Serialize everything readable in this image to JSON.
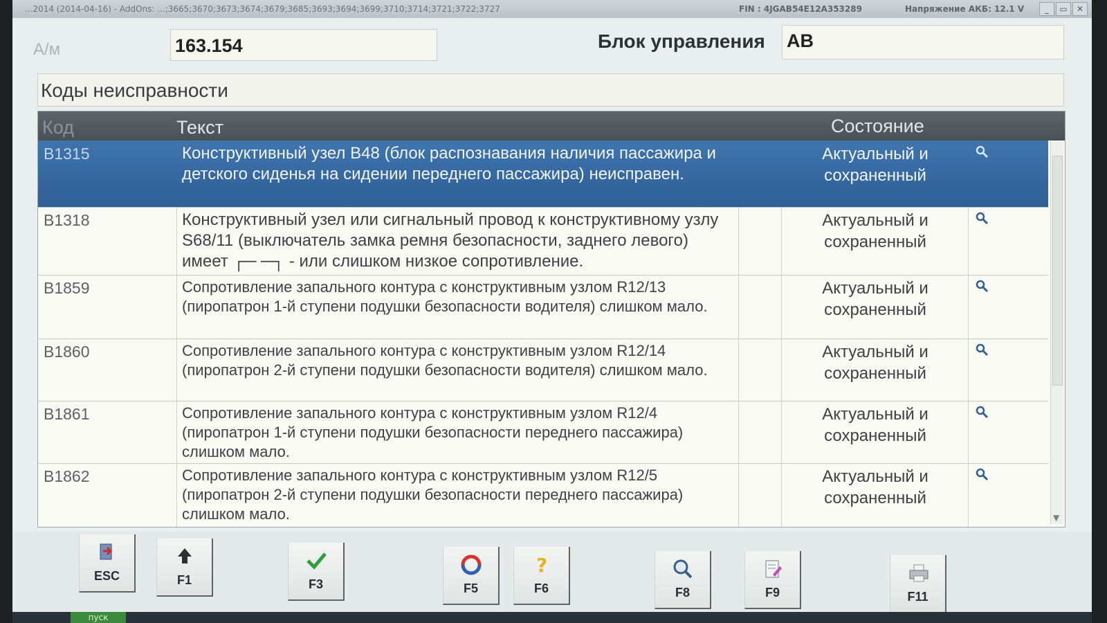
{
  "titlebar": {
    "left_text": "...2014 (2014-04-16) - AddOns: ...;3665;3670;3673;3674;3679;3685;3693;3694;3699;3710;3714;3721;3722;3727",
    "fin": "FIN : 4JGAB54E12A353289",
    "battery": "Напряжение АКБ: 12.1 V",
    "min": "_",
    "max": "▭",
    "close": "✕"
  },
  "header": {
    "am_label": "А/м",
    "am_value": "163.154",
    "control_unit_label": "Блок управления",
    "control_unit_value": "AB"
  },
  "section_title": "Коды неисправности",
  "table": {
    "columns": {
      "code": "Код",
      "text": "Текст",
      "state": "Состояние"
    },
    "rows": [
      {
        "code": "B1315",
        "text": "Конструктивный узел B48 (блок распознавания наличия пассажира и детского сиденья на сидении переднего пассажира) неисправен.",
        "state": "Актуальный и сохраненный",
        "selected": true
      },
      {
        "code": "B1318",
        "text": "Конструктивный узел или сигнальный провод к конструктивному узлу S68/11 (выключатель замка ремня безопасности, заднего левого) имеет ┌─ ─┐ - или слишком низкое сопротивление.",
        "state": "Актуальный и сохраненный"
      },
      {
        "code": "B1859",
        "text": "Сопротивление запального контура с конструктивным узлом R12/13 (пиропатрон 1-й ступени подушки безопасности водителя) слишком мало.",
        "state": "Актуальный и сохраненный"
      },
      {
        "code": "B1860",
        "text": "Сопротивление запального контура с конструктивным узлом R12/14 (пиропатрон 2-й ступени подушки безопасности водителя) слишком мало.",
        "state": "Актуальный и сохраненный"
      },
      {
        "code": "B1861",
        "text": "Сопротивление запального контура с конструктивным узлом R12/4 (пиропатрон 1-й ступени подушки безопасности переднего пассажира) слишком мало.",
        "state": "Актуальный и сохраненный"
      },
      {
        "code": "B1862",
        "text": "Сопротивление запального контура с конструктивным узлом R12/5 (пиропатрон 2-й ступени подушки безопасности переднего пассажира) слишком мало.",
        "state": "Актуальный и сохраненный"
      }
    ]
  },
  "function_keys": [
    {
      "label": "ESC",
      "icon": "exit-door-icon"
    },
    {
      "label": "F1",
      "icon": "up-arrow-icon"
    },
    {
      "label": "F3",
      "icon": "checkmark-icon"
    },
    {
      "label": "F5",
      "icon": "refresh-icon"
    },
    {
      "label": "F6",
      "icon": "help-icon"
    },
    {
      "label": "F8",
      "icon": "magnifier-icon"
    },
    {
      "label": "F9",
      "icon": "edit-document-icon"
    },
    {
      "label": "F11",
      "icon": "printer-icon"
    }
  ],
  "taskbar": {
    "start_label": "пуск"
  },
  "colors": {
    "selected_row": "#3a6ba3",
    "header_bg": "#535b5f",
    "check": "#2f9e3a",
    "refresh_red": "#d8322d",
    "refresh_blue": "#2f5fb0",
    "help_yellow": "#e2b41c"
  }
}
